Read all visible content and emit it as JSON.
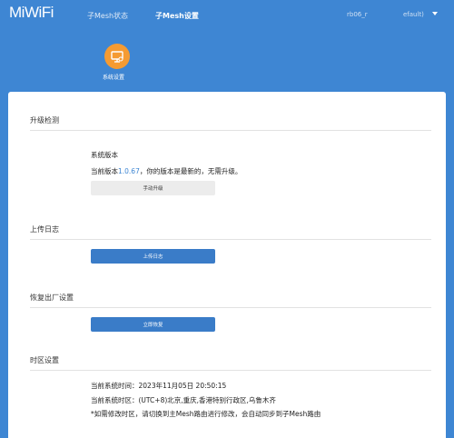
{
  "header": {
    "logo": "MiWiFi",
    "nav": [
      {
        "label": "子Mesh状态"
      },
      {
        "label": "子Mesh设置"
      }
    ],
    "device": "rb06_r",
    "account": "efault)"
  },
  "system_settings": {
    "label": "系统设置",
    "icon": "monitor-gear-icon"
  },
  "upgrade": {
    "title": "升级检测",
    "subtitle": "系统版本",
    "status_prefix": "当前版本",
    "version": "1.0.67",
    "status_suffix": "，你的版本是最新的，无需升级。",
    "button": "手动升级"
  },
  "log": {
    "title": "上传日志",
    "button": "上传日志"
  },
  "reset": {
    "title": "恢复出厂设置",
    "button": "立即恢复"
  },
  "timezone": {
    "title": "时区设置",
    "time_line": "当前系统时间：2023年11月05日 20:50:15",
    "zone_line": "当前系统时区：(UTC+8)北京,重庆,香港特别行政区,乌鲁木齐",
    "note": "*如需修改时区，请切换到主Mesh路由进行修改，会自动同步到子Mesh路由"
  },
  "colors": {
    "accent": "#3e86d3",
    "orange": "#f59b32"
  }
}
